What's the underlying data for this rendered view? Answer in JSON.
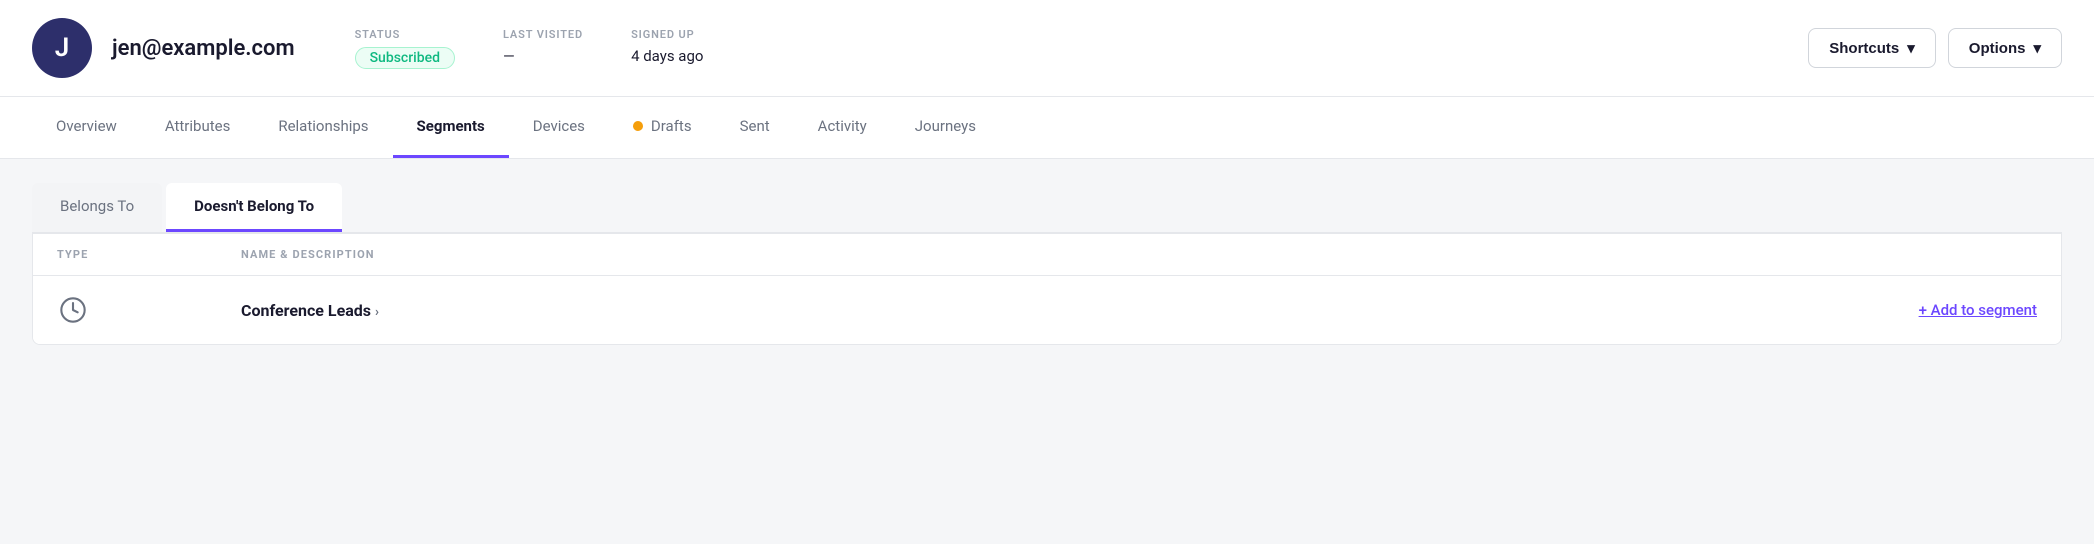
{
  "header": {
    "avatar_letter": "J",
    "email": "jen@example.com",
    "status_label": "STATUS",
    "status_value": "Subscribed",
    "last_visited_label": "LAST VISITED",
    "last_visited_value": "—",
    "signed_up_label": "SIGNED UP",
    "signed_up_value": "4 days ago",
    "shortcuts_label": "Shortcuts",
    "options_label": "Options"
  },
  "nav": {
    "tabs": [
      {
        "label": "Overview",
        "active": false
      },
      {
        "label": "Attributes",
        "active": false
      },
      {
        "label": "Relationships",
        "active": false
      },
      {
        "label": "Segments",
        "active": true
      },
      {
        "label": "Devices",
        "active": false
      },
      {
        "label": "Drafts",
        "active": false,
        "dot": true
      },
      {
        "label": "Sent",
        "active": false
      },
      {
        "label": "Activity",
        "active": false
      },
      {
        "label": "Journeys",
        "active": false
      }
    ]
  },
  "sub_tabs": [
    {
      "label": "Belongs To",
      "active": false
    },
    {
      "label": "Doesn't Belong To",
      "active": true
    }
  ],
  "table": {
    "col_type": "TYPE",
    "col_name": "NAME & DESCRIPTION",
    "rows": [
      {
        "icon": "⏱",
        "name": "Conference Leads",
        "add_label": "+ Add to segment"
      }
    ]
  }
}
